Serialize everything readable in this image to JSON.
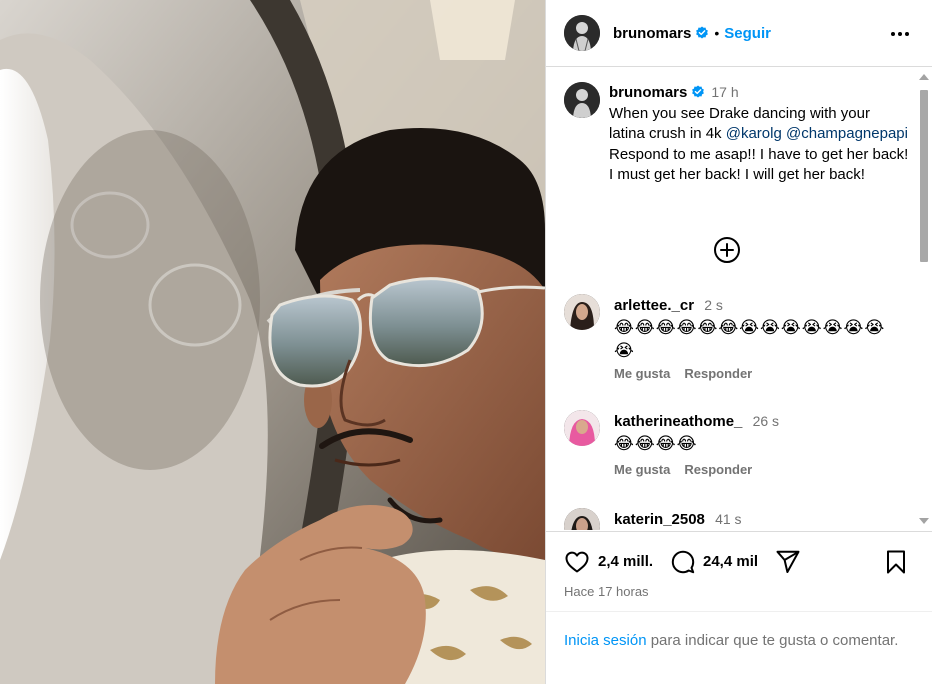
{
  "post": {
    "username": "brunomars",
    "follow_label": "Seguir",
    "dot": "•",
    "caption": {
      "username": "brunomars",
      "time": "17 h",
      "text_1": "When you see Drake dancing with your latina crush in 4k ",
      "mention_1": "@karolg",
      "mention_2": "@champagnepapi",
      "text_2": " Respond to me asap!! I have to get her back! I must get her back! I will get her back!"
    },
    "comments": [
      {
        "username": "arlettee._cr",
        "time": "2 s",
        "text": "😂😂😂😂😂😂😭😭😭😭😭😭😭😭",
        "like_label": "Me gusta",
        "reply_label": "Responder"
      },
      {
        "username": "katherineathome_",
        "time": "26 s",
        "text": "😂😂😂😂",
        "like_label": "Me gusta",
        "reply_label": "Responder"
      },
      {
        "username": "katerin_2508",
        "time": "41 s"
      }
    ],
    "likes": "2,4 mill.",
    "comments_count": "24,4 mil",
    "since": "Hace 17 horas",
    "login": {
      "link": "Inicia sesión",
      "text": " para indicar que te gusta o comentar."
    }
  },
  "icons": {
    "verified": "verified-badge-icon",
    "more": "more-options-icon",
    "add": "add-circle-icon",
    "like": "heart-icon",
    "comment": "comment-bubble-icon",
    "share": "share-paper-plane-icon",
    "save": "bookmark-icon"
  },
  "colors": {
    "link_blue": "#0095f6",
    "mention_blue": "#00376b",
    "secondary_text": "#737373",
    "border": "#dbdbdb",
    "verified": "#0095f6"
  }
}
